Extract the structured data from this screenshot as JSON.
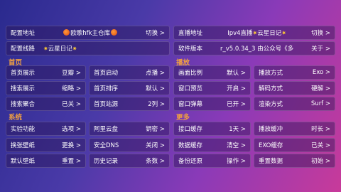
{
  "row1": {
    "source": {
      "label": "配置地址",
      "value": "欧歌hfk主仓库",
      "action": "切换 >"
    },
    "live": {
      "label": "直播地址",
      "value": "Ipv4直播",
      "value2": "云星日记",
      "action": "切换 >"
    }
  },
  "row2": {
    "line": {
      "label": "配置线路",
      "value": "云星日记"
    },
    "version": {
      "label": "软件版本",
      "value": "r_v5.0.34_3 由公众号《多",
      "action": "关于 >"
    }
  },
  "sections": {
    "home": "首页",
    "play": "播放",
    "system": "系统",
    "more": "更多"
  },
  "home_rows": [
    [
      {
        "label": "首页展示",
        "value": "豆瓣 >"
      },
      {
        "label": "首页启动",
        "value": "点播 >"
      }
    ],
    [
      {
        "label": "搜索展示",
        "value": "缩略 >"
      },
      {
        "label": "首页排序",
        "value": "默认 >"
      }
    ],
    [
      {
        "label": "搜索聚合",
        "value": "已关 >"
      },
      {
        "label": "首页站源",
        "value": "2列 >"
      }
    ]
  ],
  "play_rows": [
    [
      {
        "label": "画面比例",
        "value": "默认 >"
      },
      {
        "label": "播放方式",
        "value": "Exo >"
      }
    ],
    [
      {
        "label": "窗口预览",
        "value": "开启 >"
      },
      {
        "label": "解码方式",
        "value": "硬解 >"
      }
    ],
    [
      {
        "label": "窗口弹幕",
        "value": "已开 >"
      },
      {
        "label": "渲染方式",
        "value": "Surf >"
      }
    ]
  ],
  "system_rows": [
    [
      {
        "label": "实验功能",
        "value": "选项 >"
      },
      {
        "label": "阿里云盘",
        "value": "钥密 >"
      }
    ],
    [
      {
        "label": "换张壁纸",
        "value": "更换 >"
      },
      {
        "label": "安全DNS",
        "value": "关闭 >"
      }
    ],
    [
      {
        "label": "默认壁纸",
        "value": "重置 >"
      },
      {
        "label": "历史记录",
        "value": "条数 >"
      }
    ]
  ],
  "more_rows": [
    [
      {
        "label": "接口缓存",
        "value": "1天 >"
      },
      {
        "label": "播放缓冲",
        "value": "时长 >"
      }
    ],
    [
      {
        "label": "数据缓存",
        "value": "清空 >"
      },
      {
        "label": "EXO缓存",
        "value": "已关 >"
      }
    ],
    [
      {
        "label": "备份还原",
        "value": "操作 >"
      },
      {
        "label": "重置数据",
        "value": "初始 >"
      }
    ]
  ],
  "colors": {
    "section": "#f0a040",
    "accent_dot": "#e04a10"
  }
}
